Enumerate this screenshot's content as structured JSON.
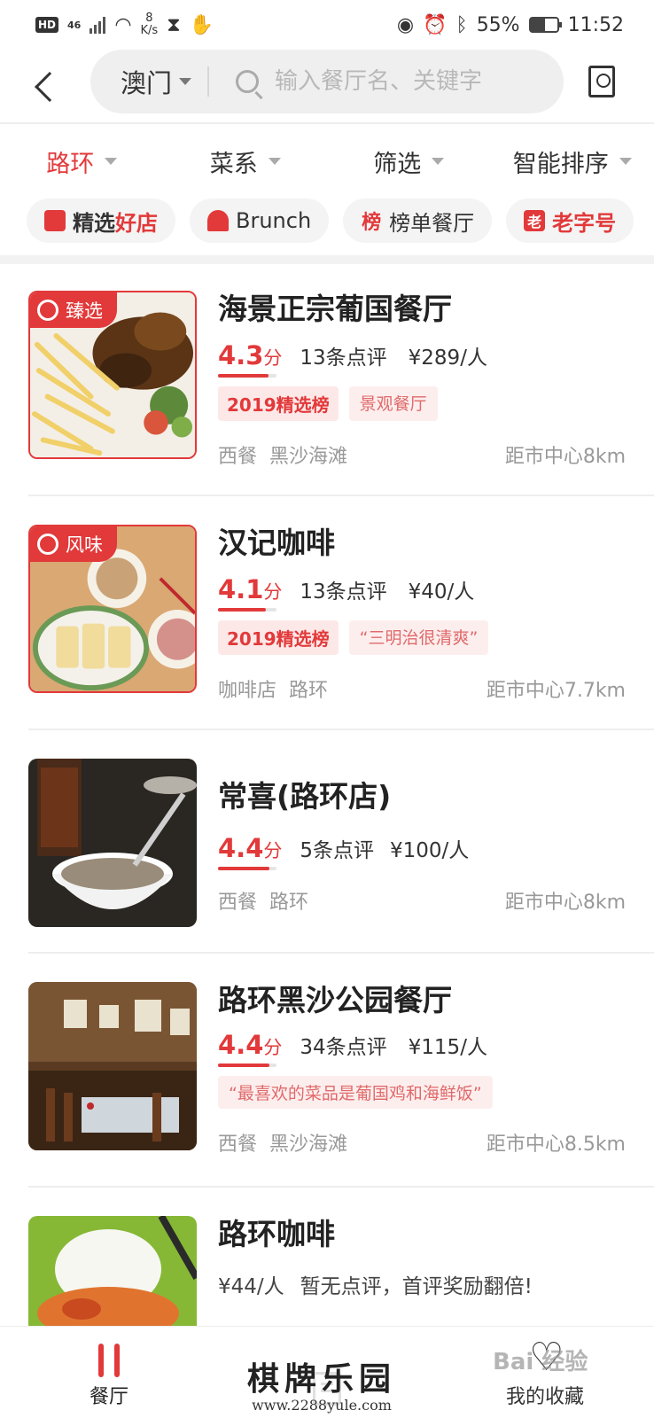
{
  "status_bar": {
    "left_badges": [
      "HD",
      "46"
    ],
    "speed_value": "8",
    "speed_unit": "K/s",
    "battery": "55%",
    "battery_level": 0.55,
    "time": "11:52"
  },
  "header": {
    "city": "澳门",
    "search_placeholder": "输入餐厅名、关键字"
  },
  "filters": [
    {
      "label": "路环",
      "active": true
    },
    {
      "label": "菜系",
      "active": false
    },
    {
      "label": "筛选",
      "active": false
    },
    {
      "label": "智能排序",
      "active": false
    }
  ],
  "quick_tags": [
    {
      "icon": "store-icon",
      "label_a": "精选",
      "label_b": "好店"
    },
    {
      "icon": "dish-cover-icon",
      "label": "Brunch"
    },
    {
      "icon": "ranking-icon",
      "icon_text": "榜",
      "label": "榜单餐厅"
    },
    {
      "icon": "old-brand-icon",
      "icon_text": "老",
      "label": "老字号"
    }
  ],
  "restaurants": [
    {
      "name": "海景正宗葡国餐厅",
      "badge": "臻选",
      "score": "4.3",
      "score_unit": "分",
      "score_value": 4.3,
      "reviews": "13条点评",
      "price": "¥289/人",
      "tag_rank": "2019精选榜",
      "tag_soft": "景观餐厅",
      "cuisine": "西餐",
      "area": "黑沙海滩",
      "distance": "距市中心8km"
    },
    {
      "name": "汉记咖啡",
      "badge": "风味",
      "score": "4.1",
      "score_unit": "分",
      "score_value": 4.1,
      "reviews": "13条点评",
      "price": "¥40/人",
      "tag_rank": "2019精选榜",
      "tag_soft": "“三明治很清爽”",
      "cuisine": "咖啡店",
      "area": "路环",
      "distance": "距市中心7.7km"
    },
    {
      "name": "常喜(路环店)",
      "score": "4.4",
      "score_unit": "分",
      "score_value": 4.4,
      "reviews": "5条点评",
      "price": "¥100/人",
      "cuisine": "西餐",
      "area": "路环",
      "distance": "距市中心8km"
    },
    {
      "name": "路环黑沙公园餐厅",
      "score": "4.4",
      "score_unit": "分",
      "score_value": 4.4,
      "reviews": "34条点评",
      "price": "¥115/人",
      "tag_soft": "“最喜欢的菜品是葡国鸡和海鲜饭”",
      "cuisine": "西餐",
      "area": "黑沙海滩",
      "distance": "距市中心8.5km"
    },
    {
      "name": "路环咖啡",
      "price": "¥44/人",
      "no_review_text": "暂无点评，首评奖励翻倍!"
    }
  ],
  "bottom_nav": [
    {
      "label": "餐厅",
      "icon": "fork-knife-icon",
      "active": true
    },
    {
      "label": "",
      "icon": "list-icon",
      "active": false
    },
    {
      "label": "我的收藏",
      "icon": "heart-icon",
      "active": false
    }
  ],
  "watermark": {
    "title": "棋牌乐园",
    "url": "www.2288yule.com",
    "baidu": "Bai 经验"
  },
  "colors": {
    "accent": "#e2393a",
    "search_bg": "#efefef",
    "secondary_text": "#999999"
  }
}
